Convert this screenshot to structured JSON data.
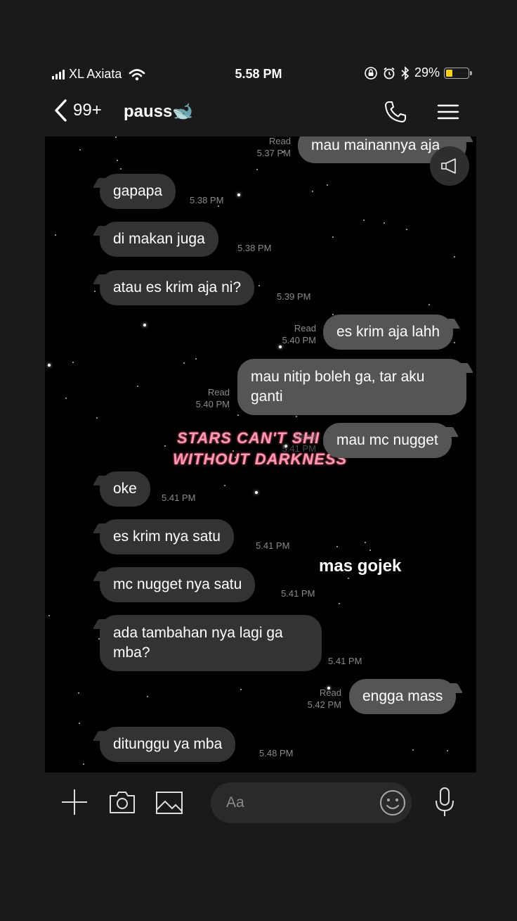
{
  "status_bar": {
    "carrier": "XL Axiata",
    "time": "5.58 PM",
    "battery": "29%",
    "battery_level": 0.29
  },
  "header": {
    "back_count": "99+",
    "contact_name": "pauss🐋"
  },
  "messages": [
    {
      "dir": "out",
      "text": "mau mainannya aja",
      "read": "Read",
      "time": "5.37 PM"
    },
    {
      "dir": "in",
      "text": "gapapa",
      "time": "5.38 PM"
    },
    {
      "dir": "in",
      "text": "di makan juga",
      "time": "5.38 PM"
    },
    {
      "dir": "in",
      "text": "atau es krim aja ni?",
      "time": "5.39 PM"
    },
    {
      "dir": "out",
      "text": "es krim aja lahh",
      "read": "Read",
      "time": "5.40 PM"
    },
    {
      "dir": "out",
      "text": "mau nitip boleh ga, tar aku ganti",
      "read": "Read",
      "time": "5.40 PM"
    },
    {
      "dir": "out",
      "text": "mau mc nugget",
      "read": "Read",
      "time": "5.41 PM"
    },
    {
      "dir": "in",
      "text": "oke",
      "time": "5.41 PM"
    },
    {
      "dir": "in",
      "text": "es krim nya satu",
      "time": "5.41 PM"
    },
    {
      "dir": "in",
      "text": "mc nugget nya satu",
      "time": "5.41 PM"
    },
    {
      "dir": "in",
      "text": "ada tambahan nya lagi ga mba?",
      "time": "5.41 PM"
    },
    {
      "dir": "out",
      "text": "engga mass",
      "read": "Read",
      "time": "5.42 PM"
    },
    {
      "dir": "in",
      "text": "ditunggu ya mba",
      "time": "5.48 PM"
    }
  ],
  "overlay": {
    "line1": "STARS CAN'T SHI",
    "line2": "WITHOUT DARKNESS",
    "caption": "mas gojek"
  },
  "composer": {
    "placeholder": "Aa"
  }
}
